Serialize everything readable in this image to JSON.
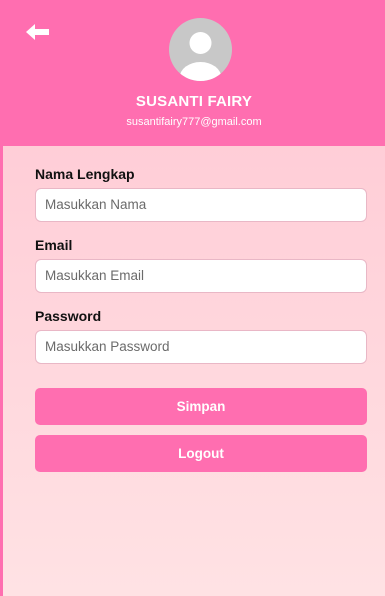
{
  "profile": {
    "name": "SUSANTI FAIRY",
    "email": "susantifairy777@gmail.com"
  },
  "form": {
    "fullname": {
      "label": "Nama Lengkap",
      "placeholder": "Masukkan Nama"
    },
    "email": {
      "label": "Email",
      "placeholder": "Masukkan Email"
    },
    "password": {
      "label": "Password",
      "placeholder": "Masukkan Password"
    }
  },
  "buttons": {
    "save": "Simpan",
    "logout": "Logout"
  },
  "icons": {
    "back": "arrow-left-icon",
    "avatar": "user-avatar-icon"
  },
  "colors": {
    "accent": "#ff6eb0",
    "background_top": "#ffc7d3",
    "background_bottom": "#ffe2e4"
  }
}
